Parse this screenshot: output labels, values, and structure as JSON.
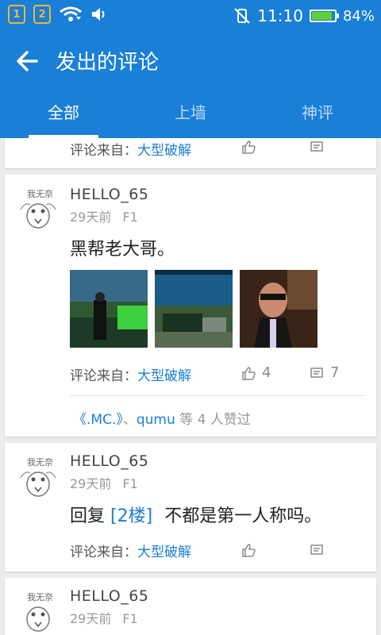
{
  "status_bar": {
    "sim1": "1",
    "sim2": "2",
    "time": "11:10",
    "battery": "84%",
    "battery_level": 0.84
  },
  "app_bar": {
    "title": "发出的评论"
  },
  "tabs": [
    {
      "label": "全部",
      "active": true
    },
    {
      "label": "上墙",
      "active": false
    },
    {
      "label": "神评",
      "active": false
    }
  ],
  "source_prefix": "评论来自：",
  "comments": [
    {
      "source_label": "评论来自：",
      "source_name": "大型破解"
    },
    {
      "username": "HELLO_65",
      "time": "29天前",
      "floor": "F1",
      "text": "黑帮老大哥。",
      "source_label": "评论来自：",
      "source_name": "大型破解",
      "like_count": "4",
      "comment_count": "7",
      "liked_by": [
        "《.MC.》",
        "qumu"
      ],
      "liked_separator": "、",
      "liked_suffix": "等 4 人赞过"
    },
    {
      "username": "HELLO_65",
      "time": "29天前",
      "floor": "F1",
      "reply_prefix": "回复",
      "reply_target": "[2楼]",
      "reply_text": "不都是第一人称吗。",
      "source_label": "评论来自：",
      "source_name": "大型破解"
    },
    {
      "username": "HELLO_65",
      "time": "29天前",
      "floor": "F1"
    }
  ],
  "colors": {
    "primary": "#1a7fd6",
    "link": "#1a7fd6",
    "background": "#ececec"
  }
}
